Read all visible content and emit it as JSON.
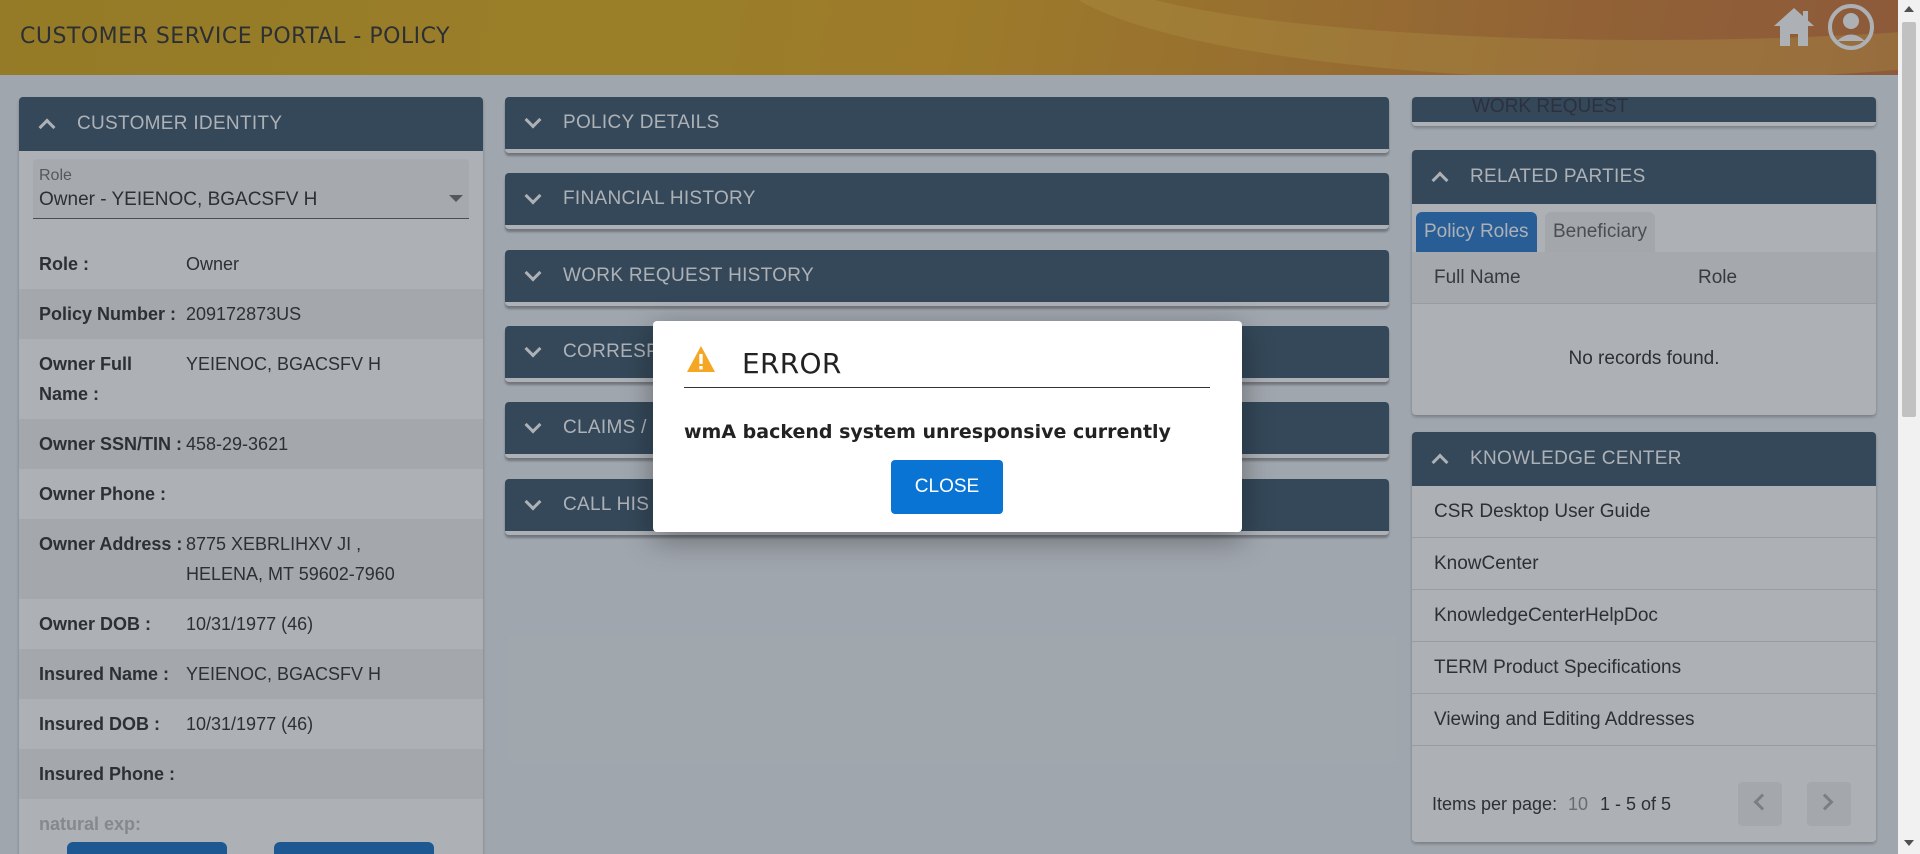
{
  "header": {
    "title": "CUSTOMER SERVICE PORTAL - POLICY",
    "home_icon": "home-icon",
    "user_icon": "user-account-icon"
  },
  "customer_identity": {
    "title": "CUSTOMER IDENTITY",
    "role_label": "Role",
    "role_value": "Owner - YEIENOC, BGACSFV H",
    "rows": [
      {
        "key": "Role :",
        "value": "Owner"
      },
      {
        "key": "Policy Number :",
        "value": "209172873US"
      },
      {
        "key": "Owner Full Name :",
        "value": "YEIENOC, BGACSFV H"
      },
      {
        "key": "Owner SSN/TIN :",
        "value": "458-29-3621"
      },
      {
        "key": "Owner Phone :",
        "value": ""
      },
      {
        "key": "Owner Address :",
        "value": "8775 XEBRLIHXV JI , HELENA, MT 59602-7960"
      },
      {
        "key": "Owner DOB :",
        "value": "10/31/1977 (46)"
      },
      {
        "key": "Insured Name :",
        "value": "YEIENOC, BGACSFV H"
      },
      {
        "key": "Insured DOB :",
        "value": "10/31/1977 (46)"
      },
      {
        "key": "Insured Phone :",
        "value": ""
      }
    ],
    "partial_row": "natural exp:"
  },
  "accordions": [
    "POLICY DETAILS",
    "FINANCIAL HISTORY",
    "WORK REQUEST HISTORY",
    "CORRESP",
    "CLAIMS /",
    "CALL HIS"
  ],
  "work_request": {
    "title": "WORK REQUEST"
  },
  "related_parties": {
    "title": "RELATED PARTIES",
    "tabs": [
      "Policy Roles",
      "Beneficiary"
    ],
    "columns": [
      "Full Name",
      "Role"
    ],
    "empty": "No records found."
  },
  "knowledge_center": {
    "title": "KNOWLEDGE CENTER",
    "items": [
      "CSR Desktop User Guide",
      "KnowCenter",
      "KnowledgeCenterHelpDoc",
      "TERM Product Specifications",
      "Viewing and Editing Addresses"
    ],
    "items_per_page_label": "Items per page:",
    "items_per_page": "10",
    "range": "1 - 5 of 5"
  },
  "dialog": {
    "title": "ERROR",
    "message": "wmA backend system unresponsive currently",
    "close_label": "CLOSE",
    "icon": "warning-icon",
    "icon_color": "#f5a623"
  }
}
